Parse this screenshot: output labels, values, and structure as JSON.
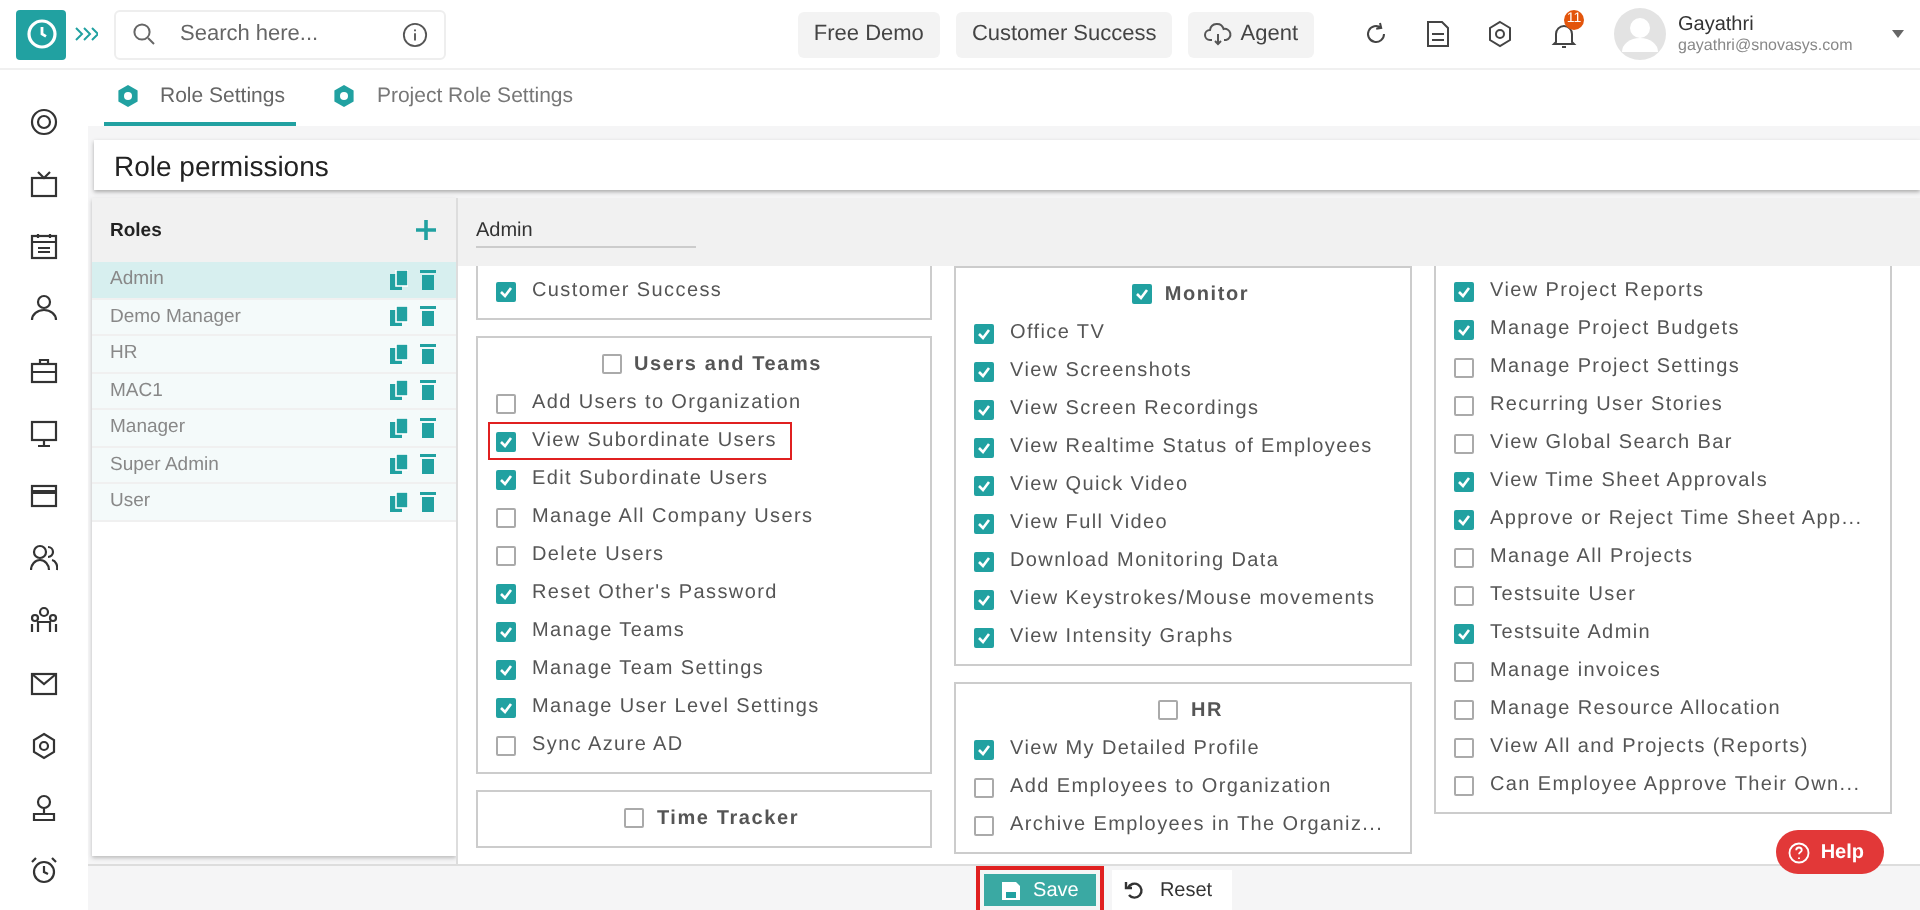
{
  "header": {
    "search": {
      "placeholder": "Search here..."
    },
    "buttons": [
      {
        "label": "Free Demo",
        "kind": "plain"
      },
      {
        "label": "Customer Success",
        "kind": "plain"
      },
      {
        "label": "Agent",
        "kind": "cloud"
      }
    ],
    "notification_count": "11",
    "user": {
      "name": "Gayathri",
      "email": "gayathri@snovasys.com"
    }
  },
  "tabs": [
    {
      "label": "Role Settings",
      "selected": true
    },
    {
      "label": "Project Role Settings",
      "selected": false
    }
  ],
  "page_title": "Role permissions",
  "roles": {
    "title": "Roles",
    "items": [
      {
        "name": "Admin",
        "selected": true
      },
      {
        "name": "Demo Manager",
        "selected": false
      },
      {
        "name": "HR",
        "selected": false
      },
      {
        "name": "MAC1",
        "selected": false
      },
      {
        "name": "Manager",
        "selected": false
      },
      {
        "name": "Super Admin",
        "selected": false
      },
      {
        "name": "User",
        "selected": false
      }
    ]
  },
  "selected_role_field": {
    "value": "Admin"
  },
  "permission_columns": [
    [
      {
        "items": [
          {
            "label": "Customer Success",
            "checked": true,
            "highlighted": false
          }
        ]
      },
      {
        "title": "Users and Teams",
        "checked": false,
        "items": [
          {
            "label": "Add Users to Organization",
            "checked": false,
            "highlighted": false
          },
          {
            "label": "View Subordinate Users",
            "checked": true,
            "highlighted": true
          },
          {
            "label": "Edit Subordinate Users",
            "checked": true,
            "highlighted": false
          },
          {
            "label": "Manage All Company Users",
            "checked": false,
            "highlighted": false
          },
          {
            "label": "Delete Users",
            "checked": false,
            "highlighted": false
          },
          {
            "label": "Reset Other's Password",
            "checked": true,
            "highlighted": false
          },
          {
            "label": "Manage Teams",
            "checked": true,
            "highlighted": false
          },
          {
            "label": "Manage Team Settings",
            "checked": true,
            "highlighted": false
          },
          {
            "label": "Manage User Level Settings",
            "checked": true,
            "highlighted": false
          },
          {
            "label": "Sync Azure AD",
            "checked": false,
            "highlighted": false
          }
        ]
      },
      {
        "title": "Time Tracker",
        "checked": false
      }
    ],
    [
      {
        "title": "Monitor",
        "checked": true,
        "items": [
          {
            "label": "Office TV",
            "checked": true,
            "highlighted": false
          },
          {
            "label": "View Screenshots",
            "checked": true,
            "highlighted": false
          },
          {
            "label": "View Screen Recordings",
            "checked": true,
            "highlighted": false
          },
          {
            "label": "View Realtime Status of Employees",
            "checked": true,
            "highlighted": false
          },
          {
            "label": "View Quick Video",
            "checked": true,
            "highlighted": false
          },
          {
            "label": "View Full Video",
            "checked": true,
            "highlighted": false
          },
          {
            "label": "Download Monitoring Data",
            "checked": true,
            "highlighted": false
          },
          {
            "label": "View Keystrokes/Mouse movements",
            "checked": true,
            "highlighted": false
          },
          {
            "label": "View Intensity Graphs",
            "checked": true,
            "highlighted": false
          }
        ]
      },
      {
        "title": "HR",
        "checked": false,
        "items": [
          {
            "label": "View My Detailed Profile",
            "checked": true,
            "highlighted": false
          },
          {
            "label": "Add Employees to Organization",
            "checked": false,
            "highlighted": false
          },
          {
            "label": "Archive Employees in The Organiz...",
            "checked": false,
            "highlighted": false
          }
        ]
      }
    ],
    [
      {
        "items": [
          {
            "label": "View Project Reports",
            "checked": true,
            "highlighted": false
          },
          {
            "label": "Manage Project Budgets",
            "checked": true,
            "highlighted": false
          },
          {
            "label": "Manage Project Settings",
            "checked": false,
            "highlighted": false
          },
          {
            "label": "Recurring User Stories",
            "checked": false,
            "highlighted": false
          },
          {
            "label": "View Global Search Bar",
            "checked": false,
            "highlighted": false
          },
          {
            "label": "View Time Sheet Approvals",
            "checked": true,
            "highlighted": false
          },
          {
            "label": "Approve or Reject Time Sheet App...",
            "checked": true,
            "highlighted": false
          },
          {
            "label": "Manage All Projects",
            "checked": false,
            "highlighted": false
          },
          {
            "label": "Testsuite User",
            "checked": false,
            "highlighted": false
          },
          {
            "label": "Testsuite Admin",
            "checked": true,
            "highlighted": false
          },
          {
            "label": "Manage invoices",
            "checked": false,
            "highlighted": false
          },
          {
            "label": "Manage Resource Allocation",
            "checked": false,
            "highlighted": false
          },
          {
            "label": "View All and Projects (Reports)",
            "checked": false,
            "highlighted": false
          },
          {
            "label": "Can Employee Approve Their Own...",
            "checked": false,
            "highlighted": false
          }
        ]
      }
    ]
  ],
  "actions": {
    "save": {
      "label": "Save",
      "highlighted": true
    },
    "reset": {
      "label": "Reset"
    }
  },
  "help": "Help"
}
